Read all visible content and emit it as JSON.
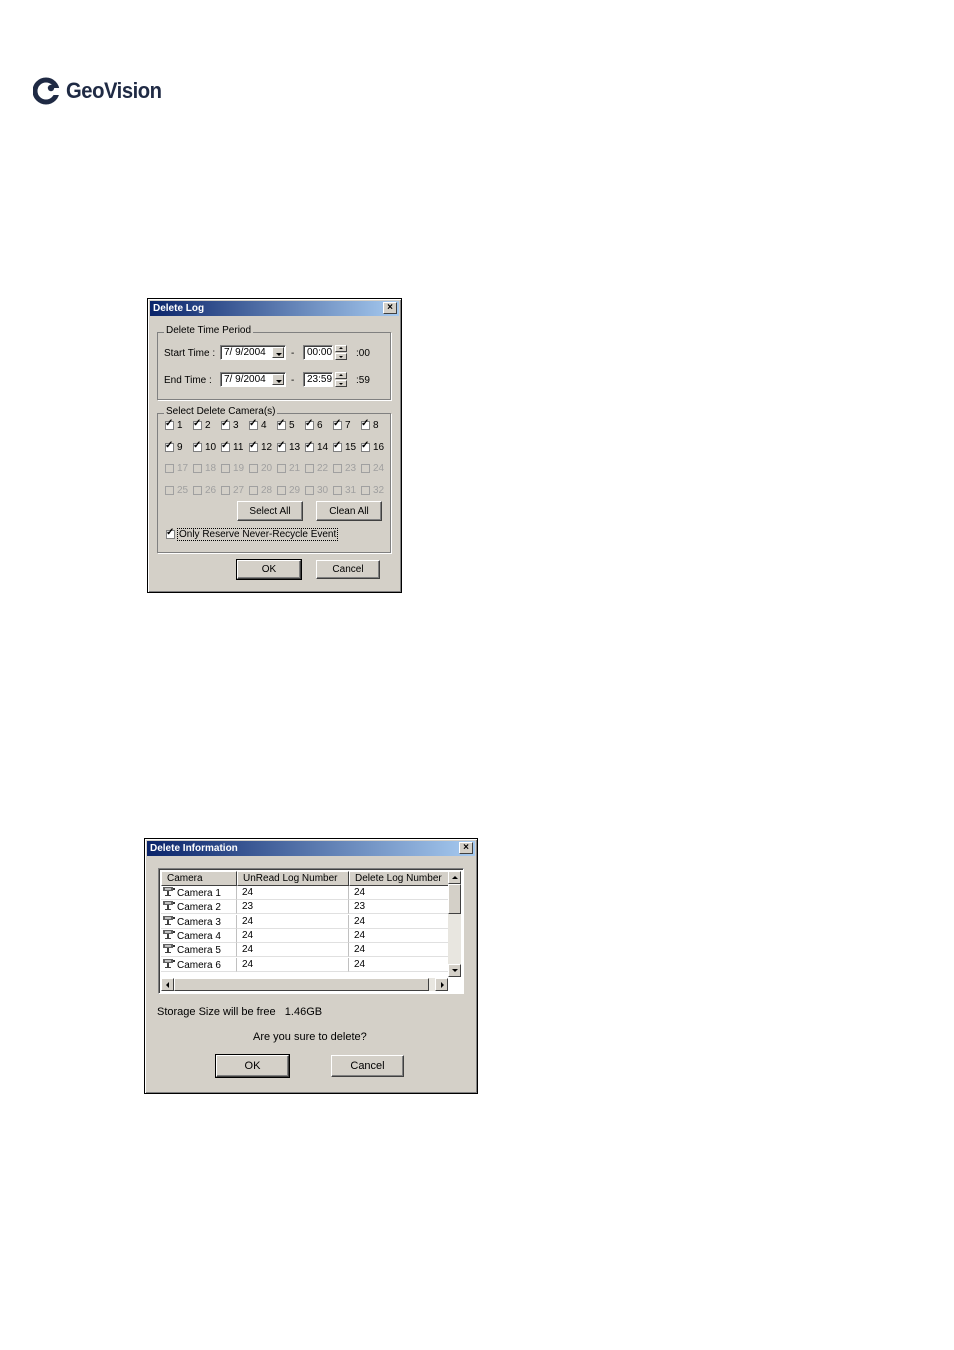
{
  "brand": {
    "name": "GeoVision",
    "logo_color": "#1f2a44"
  },
  "delete_log": {
    "title": "Delete Log",
    "time_group": "Delete Time Period",
    "start_label": "Start Time :",
    "start_date": "7/ 9/2004",
    "start_time": "00:00",
    "start_seconds": ":00",
    "end_label": "End Time :",
    "end_date": "7/ 9/2004",
    "end_time": "23:59",
    "end_seconds": ":59",
    "dash": "-",
    "camera_group": "Select Delete Camera(s)",
    "cameras": [
      {
        "label": "1",
        "checked": true,
        "enabled": true
      },
      {
        "label": "2",
        "checked": true,
        "enabled": true
      },
      {
        "label": "3",
        "checked": true,
        "enabled": true
      },
      {
        "label": "4",
        "checked": true,
        "enabled": true
      },
      {
        "label": "5",
        "checked": true,
        "enabled": true
      },
      {
        "label": "6",
        "checked": true,
        "enabled": true
      },
      {
        "label": "7",
        "checked": true,
        "enabled": true
      },
      {
        "label": "8",
        "checked": true,
        "enabled": true
      },
      {
        "label": "9",
        "checked": true,
        "enabled": true
      },
      {
        "label": "10",
        "checked": true,
        "enabled": true
      },
      {
        "label": "11",
        "checked": true,
        "enabled": true
      },
      {
        "label": "12",
        "checked": true,
        "enabled": true
      },
      {
        "label": "13",
        "checked": true,
        "enabled": true
      },
      {
        "label": "14",
        "checked": true,
        "enabled": true
      },
      {
        "label": "15",
        "checked": true,
        "enabled": true
      },
      {
        "label": "16",
        "checked": true,
        "enabled": true
      },
      {
        "label": "17",
        "checked": false,
        "enabled": false
      },
      {
        "label": "18",
        "checked": false,
        "enabled": false
      },
      {
        "label": "19",
        "checked": false,
        "enabled": false
      },
      {
        "label": "20",
        "checked": false,
        "enabled": false
      },
      {
        "label": "21",
        "checked": false,
        "enabled": false
      },
      {
        "label": "22",
        "checked": false,
        "enabled": false
      },
      {
        "label": "23",
        "checked": false,
        "enabled": false
      },
      {
        "label": "24",
        "checked": false,
        "enabled": false
      },
      {
        "label": "25",
        "checked": false,
        "enabled": false
      },
      {
        "label": "26",
        "checked": false,
        "enabled": false
      },
      {
        "label": "27",
        "checked": false,
        "enabled": false
      },
      {
        "label": "28",
        "checked": false,
        "enabled": false
      },
      {
        "label": "29",
        "checked": false,
        "enabled": false
      },
      {
        "label": "30",
        "checked": false,
        "enabled": false
      },
      {
        "label": "31",
        "checked": false,
        "enabled": false
      },
      {
        "label": "32",
        "checked": false,
        "enabled": false
      }
    ],
    "select_all": "Select All",
    "clean_all": "Clean All",
    "never_recycle_label": "Only Reserve Never-Recycle Event",
    "never_recycle_checked": true,
    "ok": "OK",
    "cancel": "Cancel"
  },
  "delete_info": {
    "title": "Delete Information",
    "columns": [
      "Camera",
      "UnRead Log Number",
      "Delete Log Number"
    ],
    "rows": [
      {
        "camera": "Camera 1",
        "unread": "24",
        "delete": "24"
      },
      {
        "camera": "Camera 2",
        "unread": "23",
        "delete": "23"
      },
      {
        "camera": "Camera 3",
        "unread": "24",
        "delete": "24"
      },
      {
        "camera": "Camera 4",
        "unread": "24",
        "delete": "24"
      },
      {
        "camera": "Camera 5",
        "unread": "24",
        "delete": "24"
      },
      {
        "camera": "Camera 6",
        "unread": "24",
        "delete": "24"
      }
    ],
    "storage_text": "Storage Size will be free   1.46GB",
    "question": "Are you sure to delete?",
    "ok": "OK",
    "cancel": "Cancel"
  }
}
